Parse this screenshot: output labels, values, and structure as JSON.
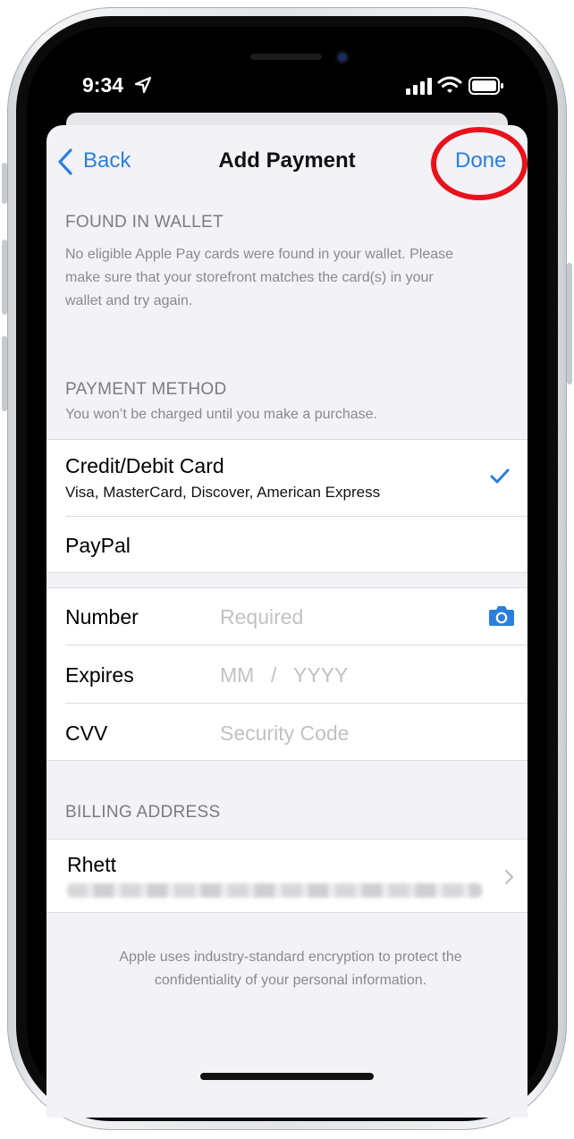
{
  "status_bar": {
    "time": "9:34",
    "icons": [
      "location-arrow-icon",
      "cellular-signal-icon",
      "wifi-icon",
      "battery-icon"
    ]
  },
  "nav": {
    "back_label": "Back",
    "title": "Add Payment",
    "done_label": "Done"
  },
  "found_in_wallet": {
    "header": "FOUND IN WALLET",
    "note_lines": [
      "No eligible Apple Pay cards were found in your wallet. Please",
      "make sure that your storefront matches the card(s) in your",
      "wallet and try again."
    ]
  },
  "payment_method": {
    "header": "PAYMENT METHOD",
    "note": "You won’t be charged until you make a purchase.",
    "options": [
      {
        "title": "Credit/Debit Card",
        "subtitle": "Visa, MasterCard, Discover, American Express",
        "selected": true
      },
      {
        "title": "PayPal",
        "subtitle": "",
        "selected": false
      }
    ]
  },
  "card_fields": {
    "number": {
      "label": "Number",
      "placeholder": "Required"
    },
    "expires": {
      "label": "Expires",
      "month_placeholder": "MM",
      "divider": "/",
      "year_placeholder": "YYYY"
    },
    "cvv": {
      "label": "CVV",
      "placeholder": "Security Code"
    }
  },
  "billing_address": {
    "header": "BILLING ADDRESS",
    "name": "Rhett"
  },
  "footer_lines": [
    "Apple uses industry-standard encryption to protect the",
    "confidentiality of your personal information."
  ],
  "colors": {
    "accent": "#2a7fde",
    "annotation_ring": "#e8121b",
    "background": "#f2f2f7"
  }
}
